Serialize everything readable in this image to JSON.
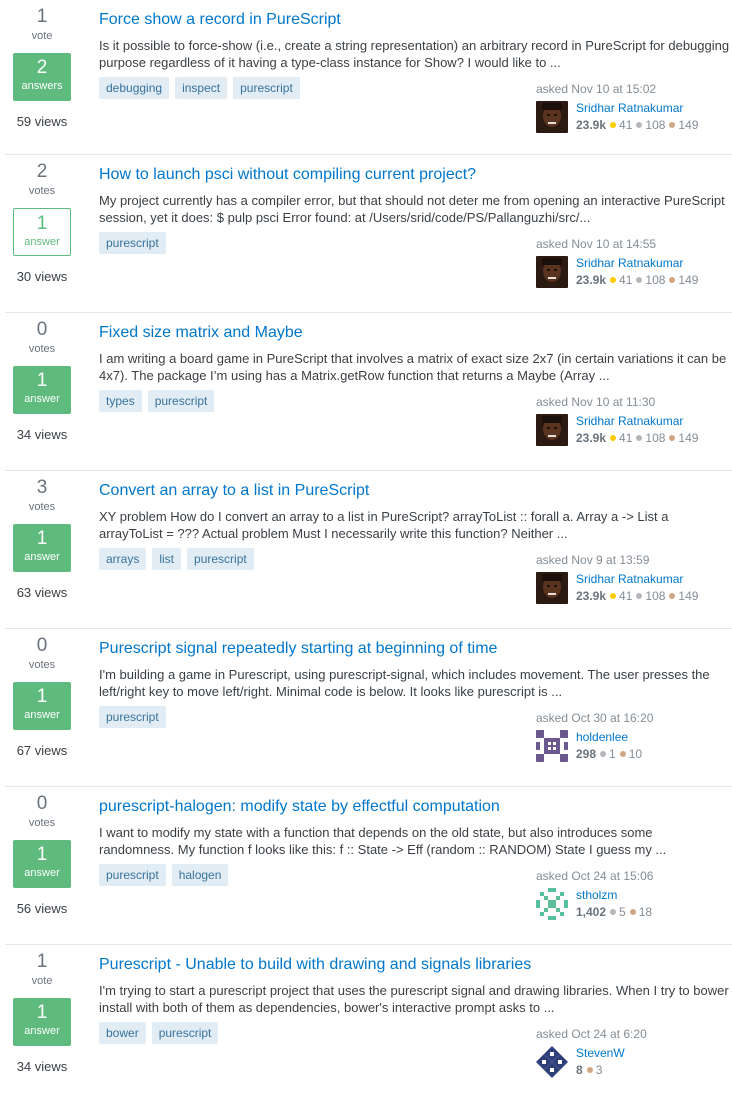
{
  "questions": [
    {
      "votes": "1",
      "votes_label": "vote",
      "answers": "2",
      "answers_label": "answers",
      "accepted": true,
      "views": "59 views",
      "title": "Force show a record in PureScript",
      "excerpt": "Is it possible to force-show (i.e., create a string representation) an arbitrary record in PureScript for debugging purpose regardless of it having a type-class instance for Show? I would like to ...",
      "tags": [
        "debugging",
        "inspect",
        "purescript"
      ],
      "asked": "asked Nov 10 at 15:02",
      "user": "Sridhar Ratnakumar",
      "avatar": "photo-avatar",
      "rep": "23.9k",
      "gold": "41",
      "silver": "108",
      "bronze": "149"
    },
    {
      "votes": "2",
      "votes_label": "votes",
      "answers": "1",
      "answers_label": "answer",
      "accepted": false,
      "views": "30 views",
      "title": "How to launch psci without compiling current project?",
      "excerpt": "My project currently has a compiler error, but that should not deter me from opening an interactive PureScript session, yet it does: $ pulp psci Error found: at /Users/srid/code/PS/Pallanguzhi/src/...",
      "tags": [
        "purescript"
      ],
      "asked": "asked Nov 10 at 14:55",
      "user": "Sridhar Ratnakumar",
      "avatar": "photo-avatar",
      "rep": "23.9k",
      "gold": "41",
      "silver": "108",
      "bronze": "149"
    },
    {
      "votes": "0",
      "votes_label": "votes",
      "answers": "1",
      "answers_label": "answer",
      "accepted": true,
      "views": "34 views",
      "title": "Fixed size matrix and Maybe",
      "excerpt": "I am writing a board game in PureScript that involves a matrix of exact size 2x7 (in certain variations it can be 4x7). The package I’m using has a Matrix.getRow function that returns a Maybe (Array ...",
      "tags": [
        "types",
        "purescript"
      ],
      "asked": "asked Nov 10 at 11:30",
      "user": "Sridhar Ratnakumar",
      "avatar": "photo-avatar",
      "rep": "23.9k",
      "gold": "41",
      "silver": "108",
      "bronze": "149"
    },
    {
      "votes": "3",
      "votes_label": "votes",
      "answers": "1",
      "answers_label": "answer",
      "accepted": true,
      "views": "63 views",
      "title": "Convert an array to a list in PureScript",
      "excerpt": "XY problem How do I convert an array to a list in PureScript? arrayToList :: forall a. Array a -> List a arrayToList = ??? Actual problem Must I necessarily write this function? Neither ...",
      "tags": [
        "arrays",
        "list",
        "purescript"
      ],
      "asked": "asked Nov 9 at 13:59",
      "user": "Sridhar Ratnakumar",
      "avatar": "photo-avatar",
      "rep": "23.9k",
      "gold": "41",
      "silver": "108",
      "bronze": "149"
    },
    {
      "votes": "0",
      "votes_label": "votes",
      "answers": "1",
      "answers_label": "answer",
      "accepted": true,
      "views": "67 views",
      "title": "Purescript signal repeatedly starting at beginning of time",
      "excerpt": "I'm building a game in Purescript, using purescript-signal, which includes movement. The user presses the left/right key to move left/right. Minimal code is below. It looks like purescript is ...",
      "tags": [
        "purescript"
      ],
      "asked": "asked Oct 30 at 16:20",
      "user": "holdenlee",
      "avatar": "identicon-purple",
      "rep": "298",
      "gold": "",
      "silver": "1",
      "bronze": "10"
    },
    {
      "votes": "0",
      "votes_label": "votes",
      "answers": "1",
      "answers_label": "answer",
      "accepted": true,
      "views": "56 views",
      "title": "purescript-halogen: modify state by effectful computation",
      "excerpt": "I want to modify my state with a function that depends on the old state, but also introduces some randomness. My function f looks like this: f :: State -> Eff (random :: RANDOM) State I guess my ...",
      "tags": [
        "purescript",
        "halogen"
      ],
      "asked": "asked Oct 24 at 15:06",
      "user": "stholzm",
      "avatar": "identicon-green",
      "rep": "1,402",
      "gold": "",
      "silver": "5",
      "bronze": "18"
    },
    {
      "votes": "1",
      "votes_label": "vote",
      "answers": "1",
      "answers_label": "answer",
      "accepted": true,
      "views": "34 views",
      "title": "Purescript - Unable to build with drawing and signals libraries",
      "excerpt": "I'm trying to start a purescript project that uses the purescript signal and drawing libraries. When I try to bower install with both of them as dependencies, bower's interactive prompt asks to ...",
      "tags": [
        "bower",
        "purescript"
      ],
      "asked": "asked Oct 24 at 6:20",
      "user": "StevenW",
      "avatar": "identicon-navy",
      "rep": "8",
      "gold": "",
      "silver": "",
      "bronze": "3"
    }
  ]
}
